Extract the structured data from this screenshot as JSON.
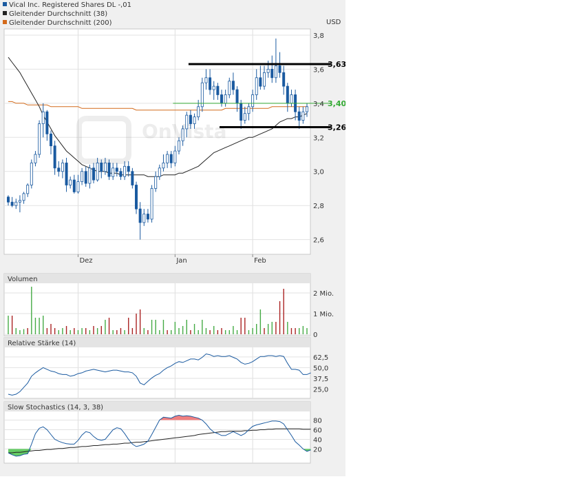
{
  "legend": {
    "items": [
      {
        "label": "Vical Inc. Registered Shares DL -,01",
        "color": "#1a5aa0"
      },
      {
        "label": "Gleitender Durchschnitt (38)",
        "color": "#222222"
      },
      {
        "label": "Gleitender Durchschnitt (200)",
        "color": "#d46a1a"
      }
    ]
  },
  "currency": "USD",
  "watermark": "OnVista",
  "chart_data": [
    {
      "name": "price-panel",
      "type": "candlestick",
      "currency": "USD",
      "x_ticks": [
        "Dez",
        "Jan",
        "Feb"
      ],
      "y_ticks": [
        "3,8",
        "3,6",
        "3,4",
        "3,2",
        "3,0",
        "2,8",
        "2,6"
      ],
      "ylim": [
        2.55,
        3.82
      ],
      "candles": [
        [
          2.85,
          2.82,
          2.86,
          2.8
        ],
        [
          2.82,
          2.8,
          2.85,
          2.79
        ],
        [
          2.8,
          2.82,
          2.84,
          2.78
        ],
        [
          2.82,
          2.83,
          2.86,
          2.76
        ],
        [
          2.83,
          2.87,
          2.88,
          2.81
        ],
        [
          2.87,
          2.92,
          2.93,
          2.85
        ],
        [
          2.92,
          3.05,
          3.07,
          2.9
        ],
        [
          3.05,
          3.1,
          3.12,
          3.03
        ],
        [
          3.1,
          3.28,
          3.3,
          3.08
        ],
        [
          3.28,
          3.35,
          3.4,
          3.2
        ],
        [
          3.35,
          3.22,
          3.36,
          3.18
        ],
        [
          3.22,
          3.15,
          3.24,
          3.1
        ],
        [
          3.15,
          3.02,
          3.18,
          2.98
        ],
        [
          3.02,
          3.0,
          3.06,
          2.97
        ],
        [
          3.0,
          3.05,
          3.07,
          2.96
        ],
        [
          3.05,
          2.92,
          3.08,
          2.88
        ],
        [
          2.92,
          2.95,
          2.97,
          2.9
        ],
        [
          2.95,
          2.88,
          2.98,
          2.87
        ],
        [
          2.88,
          2.94,
          2.98,
          2.87
        ],
        [
          2.94,
          3.0,
          3.02,
          2.92
        ],
        [
          3.0,
          2.93,
          3.03,
          2.91
        ],
        [
          2.93,
          3.02,
          3.04,
          2.9
        ],
        [
          3.02,
          2.95,
          3.05,
          2.93
        ],
        [
          2.95,
          3.05,
          3.08,
          2.94
        ],
        [
          3.05,
          3.0,
          3.07,
          2.96
        ],
        [
          3.0,
          3.05,
          3.08,
          2.98
        ],
        [
          3.05,
          2.97,
          3.07,
          2.95
        ],
        [
          2.97,
          3.02,
          3.05,
          2.95
        ],
        [
          3.02,
          3.0,
          3.05,
          2.97
        ],
        [
          3.0,
          2.97,
          3.02,
          2.95
        ],
        [
          2.97,
          3.03,
          3.06,
          2.95
        ],
        [
          3.03,
          3.0,
          3.06,
          2.97
        ],
        [
          3.0,
          2.92,
          3.02,
          2.9
        ],
        [
          2.92,
          2.78,
          2.94,
          2.75
        ],
        [
          2.78,
          2.7,
          2.82,
          2.6
        ],
        [
          2.7,
          2.75,
          2.78,
          2.68
        ],
        [
          2.75,
          2.72,
          2.78,
          2.7
        ],
        [
          2.72,
          2.9,
          2.92,
          2.7
        ],
        [
          2.9,
          2.97,
          3.0,
          2.88
        ],
        [
          2.97,
          3.02,
          3.04,
          2.95
        ],
        [
          3.02,
          3.05,
          3.1,
          3.0
        ],
        [
          3.05,
          3.1,
          3.12,
          3.02
        ],
        [
          3.1,
          3.05,
          3.12,
          3.02
        ],
        [
          3.05,
          3.12,
          3.15,
          3.03
        ],
        [
          3.12,
          3.18,
          3.2,
          3.1
        ],
        [
          3.18,
          3.25,
          3.27,
          3.15
        ],
        [
          3.25,
          3.33,
          3.35,
          3.2
        ],
        [
          3.33,
          3.28,
          3.36,
          3.25
        ],
        [
          3.28,
          3.32,
          3.34,
          3.25
        ],
        [
          3.32,
          3.38,
          3.42,
          3.3
        ],
        [
          3.38,
          3.52,
          3.55,
          3.35
        ],
        [
          3.52,
          3.55,
          3.6,
          3.48
        ],
        [
          3.55,
          3.48,
          3.6,
          3.45
        ],
        [
          3.48,
          3.5,
          3.53,
          3.42
        ],
        [
          3.5,
          3.45,
          3.52,
          3.42
        ],
        [
          3.45,
          3.4,
          3.48,
          3.38
        ],
        [
          3.4,
          3.45,
          3.48,
          3.38
        ],
        [
          3.45,
          3.53,
          3.55,
          3.43
        ],
        [
          3.53,
          3.48,
          3.58,
          3.45
        ],
        [
          3.48,
          3.4,
          3.5,
          3.35
        ],
        [
          3.4,
          3.3,
          3.42,
          3.25
        ],
        [
          3.3,
          3.34,
          3.38,
          3.28
        ],
        [
          3.34,
          3.38,
          3.4,
          3.3
        ],
        [
          3.38,
          3.45,
          3.48,
          3.35
        ],
        [
          3.45,
          3.55,
          3.6,
          3.42
        ],
        [
          3.55,
          3.5,
          3.62,
          3.48
        ],
        [
          3.5,
          3.58,
          3.62,
          3.48
        ],
        [
          3.58,
          3.6,
          3.65,
          3.55
        ],
        [
          3.6,
          3.55,
          3.68,
          3.52
        ],
        [
          3.55,
          3.62,
          3.78,
          3.52
        ],
        [
          3.62,
          3.58,
          3.7,
          3.55
        ],
        [
          3.58,
          3.5,
          3.62,
          3.45
        ],
        [
          3.5,
          3.4,
          3.52,
          3.35
        ],
        [
          3.4,
          3.45,
          3.48,
          3.38
        ],
        [
          3.45,
          3.35,
          3.48,
          3.3
        ],
        [
          3.35,
          3.3,
          3.38,
          3.25
        ],
        [
          3.3,
          3.35,
          3.38,
          3.28
        ],
        [
          3.35,
          3.38,
          3.4,
          3.32
        ]
      ],
      "ma38": [
        3.67,
        3.64,
        3.61,
        3.58,
        3.54,
        3.5,
        3.46,
        3.42,
        3.38,
        3.33,
        3.29,
        3.25,
        3.21,
        3.18,
        3.15,
        3.12,
        3.1,
        3.08,
        3.06,
        3.04,
        3.03,
        3.02,
        3.01,
        3.0,
        3.0,
        3.0,
        2.99,
        2.99,
        2.99,
        2.98,
        2.98,
        2.98,
        2.98,
        2.98,
        2.98,
        2.98,
        2.97,
        2.97,
        2.97,
        2.97,
        2.98,
        2.98,
        2.98,
        2.98,
        2.99,
        2.99,
        3.0,
        3.01,
        3.02,
        3.03,
        3.05,
        3.07,
        3.09,
        3.11,
        3.12,
        3.13,
        3.14,
        3.15,
        3.16,
        3.17,
        3.18,
        3.19,
        3.2,
        3.2,
        3.21,
        3.22,
        3.23,
        3.24,
        3.25,
        3.27,
        3.29,
        3.3,
        3.31,
        3.31,
        3.32,
        3.32,
        3.33,
        3.34
      ],
      "ma200": [
        3.41,
        3.41,
        3.4,
        3.4,
        3.4,
        3.39,
        3.39,
        3.39,
        3.39,
        3.39,
        3.39,
        3.38,
        3.38,
        3.38,
        3.38,
        3.38,
        3.38,
        3.38,
        3.38,
        3.37,
        3.37,
        3.37,
        3.37,
        3.37,
        3.37,
        3.37,
        3.37,
        3.37,
        3.37,
        3.37,
        3.37,
        3.37,
        3.37,
        3.36,
        3.36,
        3.36,
        3.36,
        3.36,
        3.36,
        3.36,
        3.36,
        3.36,
        3.36,
        3.36,
        3.36,
        3.36,
        3.36,
        3.36,
        3.36,
        3.36,
        3.36,
        3.36,
        3.36,
        3.36,
        3.36,
        3.36,
        3.37,
        3.37,
        3.37,
        3.37,
        3.37,
        3.37,
        3.37,
        3.37,
        3.37,
        3.37,
        3.37,
        3.37,
        3.38,
        3.38,
        3.38,
        3.38,
        3.38,
        3.38,
        3.38,
        3.38,
        3.38,
        3.38
      ],
      "annotations": [
        {
          "label": "3,63$",
          "value": 3.63,
          "color": "#000000",
          "from": 47,
          "to": 78
        },
        {
          "label": "3,40$",
          "value": 3.4,
          "color": "#33aa33",
          "from": 43,
          "to": 78
        },
        {
          "label": "3,26$",
          "value": 3.26,
          "color": "#000000",
          "from": 55,
          "to": 78
        }
      ]
    },
    {
      "name": "volume-panel",
      "type": "bar",
      "title": "Volumen",
      "y_ticks": [
        "2 Mio.",
        "1 Mio.",
        "0"
      ],
      "ylim": [
        0,
        2.3
      ],
      "values": [
        0.9,
        0.9,
        0.3,
        0.2,
        0.25,
        0.3,
        2.6,
        0.8,
        0.8,
        0.9,
        0.3,
        0.5,
        0.3,
        0.2,
        0.3,
        0.4,
        0.2,
        0.3,
        0.2,
        0.3,
        0.3,
        0.2,
        0.4,
        0.3,
        0.4,
        0.7,
        0.8,
        0.2,
        0.2,
        0.3,
        0.2,
        0.8,
        0.3,
        1.0,
        1.2,
        0.3,
        0.2,
        0.7,
        0.7,
        0.2,
        0.7,
        0.2,
        0.2,
        0.6,
        0.3,
        0.4,
        0.7,
        0.2,
        0.5,
        0.2,
        0.7,
        0.3,
        0.2,
        0.4,
        0.2,
        0.3,
        0.2,
        0.2,
        0.4,
        0.2,
        0.8,
        0.8,
        0.2,
        0.3,
        0.5,
        1.2,
        0.3,
        0.5,
        0.6,
        0.6,
        1.6,
        2.2,
        0.6,
        0.3,
        0.3,
        0.3,
        0.4,
        0.3
      ],
      "colors": [
        "g",
        "r",
        "g",
        "g",
        "g",
        "r",
        "g",
        "g",
        "g",
        "g",
        "r",
        "r",
        "r",
        "g",
        "g",
        "r",
        "g",
        "r",
        "g",
        "g",
        "r",
        "g",
        "r",
        "g",
        "r",
        "g",
        "r",
        "g",
        "r",
        "r",
        "g",
        "r",
        "r",
        "r",
        "r",
        "g",
        "r",
        "g",
        "g",
        "g",
        "g",
        "r",
        "g",
        "g",
        "g",
        "g",
        "g",
        "r",
        "g",
        "g",
        "g",
        "g",
        "r",
        "g",
        "r",
        "r",
        "g",
        "g",
        "g",
        "g",
        "r",
        "r",
        "g",
        "g",
        "g",
        "g",
        "r",
        "g",
        "g",
        "r",
        "r",
        "r",
        "g",
        "r",
        "r",
        "g",
        "g",
        "g"
      ]
    },
    {
      "name": "rsi-panel",
      "type": "line",
      "title": "Relative Stärke (14)",
      "y_ticks": [
        "62,5",
        "50,0",
        "37,5",
        "25,0"
      ],
      "ylim": [
        15,
        72
      ],
      "values": [
        19,
        18,
        19,
        22,
        27,
        32,
        40,
        44,
        47,
        50,
        48,
        46,
        45,
        43,
        42,
        42,
        40,
        41,
        43,
        44,
        46,
        47,
        48,
        47,
        46,
        45,
        46,
        47,
        47,
        46,
        45,
        45,
        44,
        40,
        32,
        30,
        34,
        38,
        41,
        43,
        47,
        50,
        52,
        55,
        57,
        56,
        58,
        60,
        60,
        59,
        62,
        66,
        65,
        63,
        64,
        63,
        63,
        64,
        62,
        60,
        56,
        54,
        55,
        57,
        60,
        63,
        63,
        64,
        64,
        63,
        64,
        63,
        55,
        48,
        48,
        47,
        42,
        42,
        44
      ]
    },
    {
      "name": "stochastics-panel",
      "type": "line",
      "title": "Slow Stochastics (14, 3, 38)",
      "y_ticks": [
        "80",
        "60",
        "40",
        "20"
      ],
      "ylim": [
        -8,
        95
      ],
      "upper_band": 80,
      "lower_band": 20,
      "k": [
        12,
        8,
        5,
        6,
        9,
        10,
        30,
        52,
        63,
        66,
        60,
        50,
        40,
        36,
        33,
        31,
        30,
        30,
        38,
        49,
        56,
        54,
        46,
        40,
        38,
        40,
        50,
        60,
        64,
        62,
        52,
        40,
        30,
        25,
        27,
        30,
        36,
        50,
        65,
        80,
        86,
        85,
        84,
        88,
        90,
        88,
        89,
        88,
        86,
        84,
        80,
        72,
        62,
        55,
        52,
        48,
        48,
        52,
        56,
        52,
        48,
        52,
        60,
        67,
        70,
        72,
        74,
        76,
        78,
        78,
        77,
        72,
        60,
        48,
        35,
        28,
        20,
        15,
        18
      ],
      "d": [
        12,
        12,
        13,
        13,
        14,
        15,
        16,
        17,
        17,
        18,
        19,
        19,
        20,
        21,
        21,
        22,
        23,
        23,
        24,
        25,
        25,
        26,
        27,
        27,
        28,
        29,
        29,
        30,
        30,
        31,
        32,
        32,
        33,
        34,
        34,
        35,
        36,
        37,
        38,
        39,
        40,
        41,
        42,
        43,
        44,
        45,
        46,
        47,
        48,
        50,
        51,
        52,
        53,
        54,
        55,
        56,
        56,
        57,
        57,
        57,
        57,
        58,
        58,
        59,
        59,
        60,
        60,
        61,
        61,
        62,
        62,
        62,
        62,
        62,
        62,
        62,
        61,
        61,
        61
      ]
    }
  ]
}
